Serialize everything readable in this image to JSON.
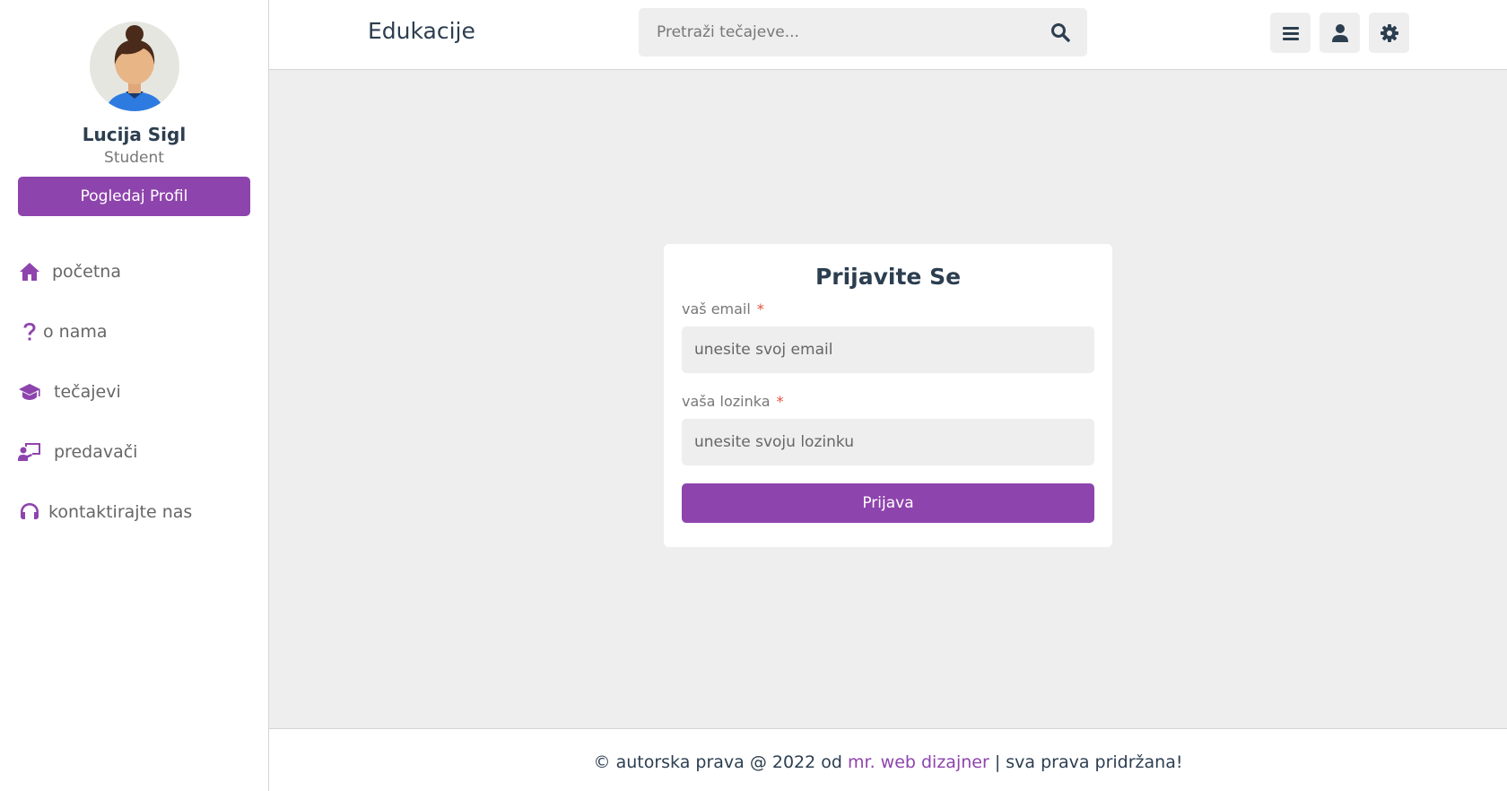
{
  "sidebar": {
    "profile": {
      "name": "Lucija Sigl",
      "role": "Student",
      "button_label": "Pogledaj Profil"
    },
    "items": [
      {
        "label": "početna",
        "icon": "home-icon"
      },
      {
        "label": "o nama",
        "icon": "question-icon"
      },
      {
        "label": "tečajevi",
        "icon": "graduation-cap-icon"
      },
      {
        "label": "predavači",
        "icon": "teacher-icon"
      },
      {
        "label": "kontaktirajte nas",
        "icon": "headset-icon"
      }
    ]
  },
  "header": {
    "logo": "Edukacije",
    "search": {
      "placeholder": "Pretraži tečajeve...",
      "icon": "search-icon"
    },
    "icons": [
      "menu-icon",
      "user-icon",
      "settings-icon"
    ]
  },
  "login": {
    "title": "Prijavite Se",
    "email_label": "vaš email",
    "email_placeholder": "unesite svoj email",
    "password_label": "vaša lozinka",
    "password_placeholder": "unesite svoju lozinku",
    "required_mark": "*",
    "submit_label": "Prijava"
  },
  "footer": {
    "prefix": "© autorska prava @ 2022 od",
    "link": "mr. web dizajner",
    "suffix": "| sva prava pridržana!"
  },
  "colors": {
    "accent": "#8e44ad",
    "text": "#2c3e50",
    "background": "#eeeeee",
    "required": "#e74c3c"
  }
}
